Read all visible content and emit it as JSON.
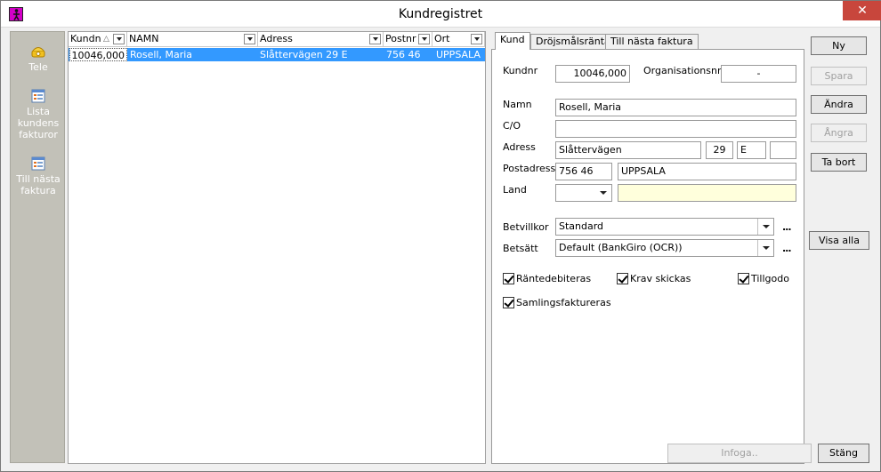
{
  "window": {
    "title": "Kundregistret",
    "close_label": "✕"
  },
  "launcher": {
    "items": [
      {
        "label": "Tele",
        "icon": "phone-icon"
      },
      {
        "label": "Lista kundens fakturor",
        "icon": "list-icon"
      },
      {
        "label": "Till nästa faktura",
        "icon": "list-icon"
      }
    ]
  },
  "grid": {
    "columns": [
      "Kundn",
      "NAMN",
      "Adress",
      "Postnr",
      "Ort"
    ],
    "sort_indicator": "△",
    "rows": [
      {
        "kundnr": "10046,000",
        "namn": "Rosell, Maria",
        "adress": "Slåttervägen 29 E",
        "postnr": "756 46",
        "ort": "UPPSALA"
      }
    ]
  },
  "tabs": [
    {
      "label": "Kund",
      "active": true
    },
    {
      "label": "Dröjsmålsränta",
      "active": false
    },
    {
      "label": "Till nästa faktura",
      "active": false
    }
  ],
  "form": {
    "kundnr_label": "Kundnr",
    "kundnr_value": "10046,000",
    "orgnr_label": "Organisationsnr.",
    "orgnr_value": "-",
    "namn_label": "Namn",
    "namn_value": "Rosell, Maria",
    "co_label": "C/O",
    "co_value": "",
    "adress_label": "Adress",
    "adress_street": "Slåttervägen",
    "adress_number": "29",
    "adress_letter": "E",
    "adress_extra": "",
    "postadress_label": "Postadress",
    "postnr_value": "756 46",
    "ort_value": "UPPSALA",
    "land_label": "Land",
    "land_value": "",
    "land_extra": "",
    "betvillkor_label": "Betvillkor",
    "betvillkor_value": "Standard",
    "betsatt_label": "Betsätt",
    "betsatt_value": "Default (BankGiro (OCR))",
    "ellipsis": "...",
    "checkboxes": [
      {
        "label": "Räntedebiteras",
        "checked": true
      },
      {
        "label": "Krav skickas",
        "checked": true
      },
      {
        "label": "Tillgodo",
        "checked": true
      },
      {
        "label": "Samlingsfaktureras",
        "checked": true
      }
    ]
  },
  "buttons": {
    "ny": "Ny",
    "spara": "Spara",
    "andra": "Ändra",
    "angra": "Ångra",
    "ta_bort": "Ta bort",
    "visa_alla": "Visa alla",
    "infoga": "Infoga..",
    "stang": "Stäng"
  }
}
